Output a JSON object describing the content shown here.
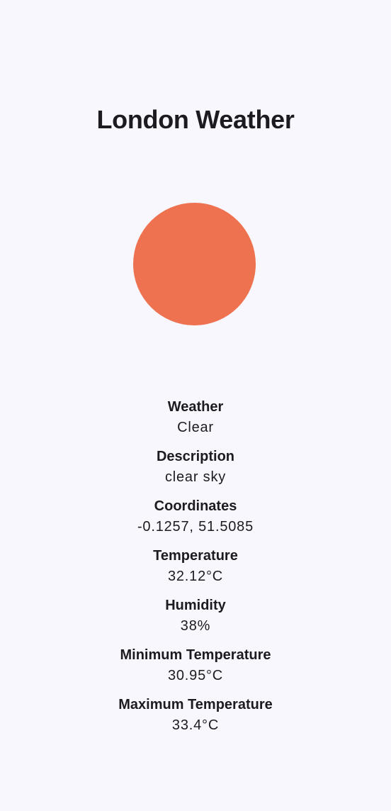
{
  "header": {
    "title": "London Weather"
  },
  "icon": {
    "name": "sun-icon",
    "color": "#ee7150"
  },
  "details": [
    {
      "label": "Weather",
      "value": "Clear"
    },
    {
      "label": "Description",
      "value": "clear sky"
    },
    {
      "label": "Coordinates",
      "value": "-0.1257, 51.5085"
    },
    {
      "label": "Temperature",
      "value": "32.12°C"
    },
    {
      "label": "Humidity",
      "value": "38%"
    },
    {
      "label": "Minimum Temperature",
      "value": "30.95°C"
    },
    {
      "label": "Maximum Temperature",
      "value": "33.4°C"
    }
  ]
}
